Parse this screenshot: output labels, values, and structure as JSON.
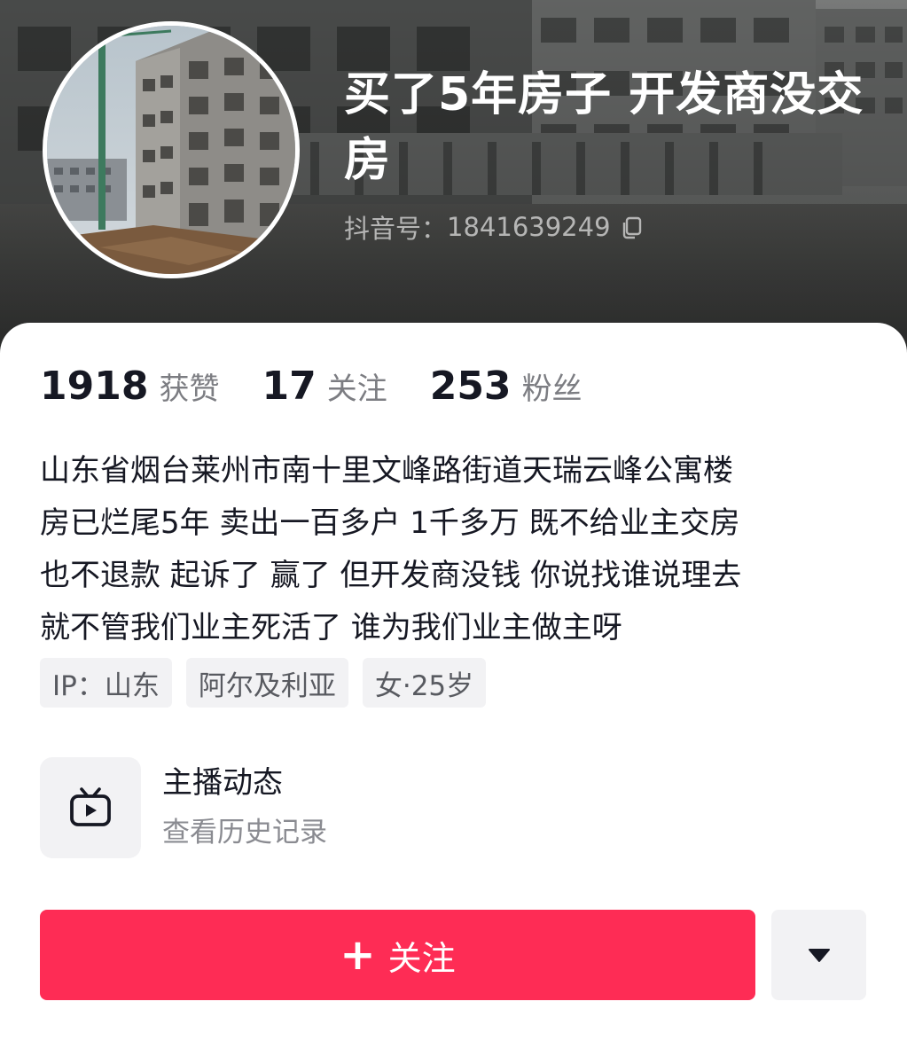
{
  "profile": {
    "name": "买了5年房子  开发商没交房",
    "account_label": "抖音号：",
    "account_id": "1841639249",
    "copy_icon": "copy-icon",
    "avatar_icon": "construction-site-photo"
  },
  "stats": [
    {
      "value": "1918",
      "label": "获赞"
    },
    {
      "value": "17",
      "label": "关注"
    },
    {
      "value": "253",
      "label": "粉丝"
    }
  ],
  "bio": {
    "lines": [
      "山东省烟台莱州市南十里文峰路街道天瑞云峰公寓楼",
      "房已烂尾5年  卖出一百多户  1千多万  既不给业主交房",
      "也不退款  起诉了  赢了  但开发商没钱  你说找谁说理去",
      "就不管我们业主死活了  谁为我们业主做主呀"
    ]
  },
  "tags": [
    "IP：山东",
    "阿尔及利亚",
    "女·25岁"
  ],
  "live": {
    "icon": "tv-icon",
    "title": "主播动态",
    "subtitle": "查看历史记录"
  },
  "actions": {
    "follow_icon": "plus-icon",
    "follow_label": "关注",
    "more_icon": "caret-down-icon"
  },
  "colors": {
    "follow_button": "#fe2c55",
    "text_primary": "#161823",
    "text_secondary": "#7c7d82",
    "tag_background": "#f2f2f4"
  }
}
